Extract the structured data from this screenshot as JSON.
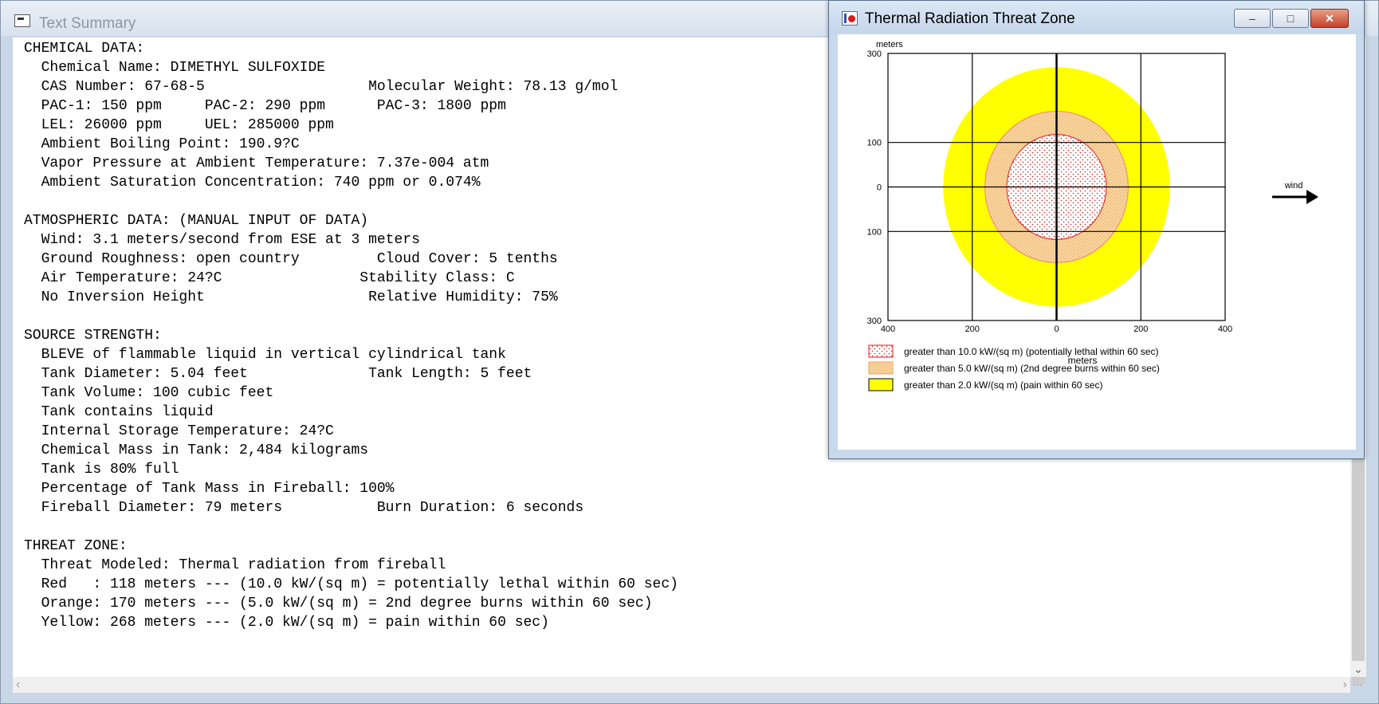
{
  "summary_window": {
    "title": "Text Summary",
    "lines": [
      "CHEMICAL DATA:",
      "  Chemical Name: DIMETHYL SULFOXIDE",
      "  CAS Number: 67-68-5                   Molecular Weight: 78.13 g/mol",
      "  PAC-1: 150 ppm     PAC-2: 290 ppm      PAC-3: 1800 ppm",
      "  LEL: 26000 ppm     UEL: 285000 ppm",
      "  Ambient Boiling Point: 190.9?C",
      "  Vapor Pressure at Ambient Temperature: 7.37e-004 atm",
      "  Ambient Saturation Concentration: 740 ppm or 0.074%",
      "",
      "ATMOSPHERIC DATA: (MANUAL INPUT OF DATA)",
      "  Wind: 3.1 meters/second from ESE at 3 meters",
      "  Ground Roughness: open country         Cloud Cover: 5 tenths",
      "  Air Temperature: 24?C                Stability Class: C",
      "  No Inversion Height                   Relative Humidity: 75%",
      "",
      "SOURCE STRENGTH:",
      "  BLEVE of flammable liquid in vertical cylindrical tank",
      "  Tank Diameter: 5.04 feet              Tank Length: 5 feet",
      "  Tank Volume: 100 cubic feet",
      "  Tank contains liquid",
      "  Internal Storage Temperature: 24?C",
      "  Chemical Mass in Tank: 2,484 kilograms",
      "  Tank is 80% full",
      "  Percentage of Tank Mass in Fireball: 100%",
      "  Fireball Diameter: 79 meters           Burn Duration: 6 seconds",
      "",
      "THREAT ZONE:",
      "  Threat Modeled: Thermal radiation from fireball",
      "  Red   : 118 meters --- (10.0 kW/(sq m) = potentially lethal within 60 sec)",
      "  Orange: 170 meters --- (5.0 kW/(sq m) = 2nd degree burns within 60 sec)",
      "  Yellow: 268 meters --- (2.0 kW/(sq m) = pain within 60 sec)"
    ]
  },
  "threat_window": {
    "title": "Thermal Radiation Threat Zone",
    "buttons": {
      "minimize": "–",
      "maximize": "□",
      "close": "✕"
    }
  },
  "chart_data": {
    "type": "threat-zone",
    "ylabel": "meters",
    "xlabel": "meters",
    "x_ticks": [
      "400",
      "200",
      "0",
      "200",
      "400"
    ],
    "y_ticks": [
      "300",
      "100",
      "0",
      "100",
      "300"
    ],
    "x_tick_values": [
      -400,
      -200,
      0,
      200,
      400
    ],
    "y_tick_values": [
      300,
      100,
      0,
      -100,
      -300
    ],
    "xlim": [
      -400,
      400
    ],
    "ylim": [
      -300,
      300
    ],
    "zones": [
      {
        "radius_m": 268,
        "color": "#ffff00",
        "stroke": "#ffff00",
        "pattern": "solid"
      },
      {
        "radius_m": 170,
        "color": "#f7d8a8",
        "stroke": "#f08080",
        "pattern": "orange-dots"
      },
      {
        "radius_m": 118,
        "color": "#ffffff",
        "stroke": "#e01818",
        "pattern": "red-dots"
      }
    ],
    "wind_label": "wind",
    "legend": [
      {
        "label": "greater than 10.0 kW/(sq m) (potentially lethal within 60 sec)",
        "pattern": "red-dots"
      },
      {
        "label": "greater than 5.0 kW/(sq m) (2nd degree burns within 60 sec)",
        "pattern": "orange-dots"
      },
      {
        "label": "greater than 2.0 kW/(sq m) (pain within 60 sec)",
        "pattern": "solid"
      }
    ]
  }
}
